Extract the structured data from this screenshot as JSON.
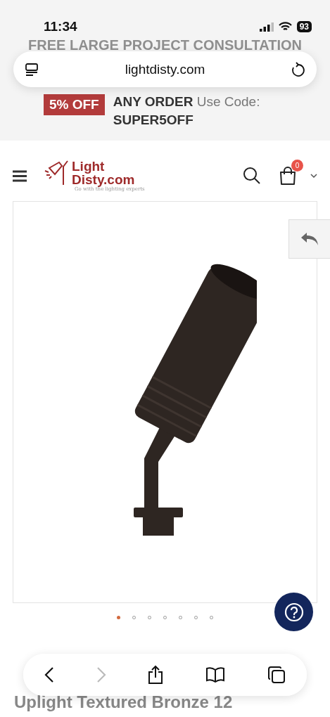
{
  "status_bar": {
    "time": "11:34",
    "battery": "93"
  },
  "promo_banner": {
    "headline": "FREE LARGE PROJECT CONSULTATION",
    "badge": "5% OFF",
    "offer": "**ANY ORDER** Use Code:",
    "code": "SUPER5OFF"
  },
  "address_bar": {
    "url": "lightdisty.com"
  },
  "header": {
    "logo_line_1": "Light",
    "logo_line_2": "Disty.com",
    "tagline": "Go with the lighting experts",
    "cart_count": "0"
  },
  "gallery": {
    "dots": [
      {
        "selected": true
      },
      {
        "selected": false
      },
      {
        "selected": false
      },
      {
        "selected": false
      },
      {
        "selected": false
      },
      {
        "selected": false
      },
      {
        "selected": false
      }
    ]
  },
  "product": {
    "title_visible": "Uplight Textured Bronze 12"
  },
  "toolbar": {
    "forward_disabled": true
  }
}
